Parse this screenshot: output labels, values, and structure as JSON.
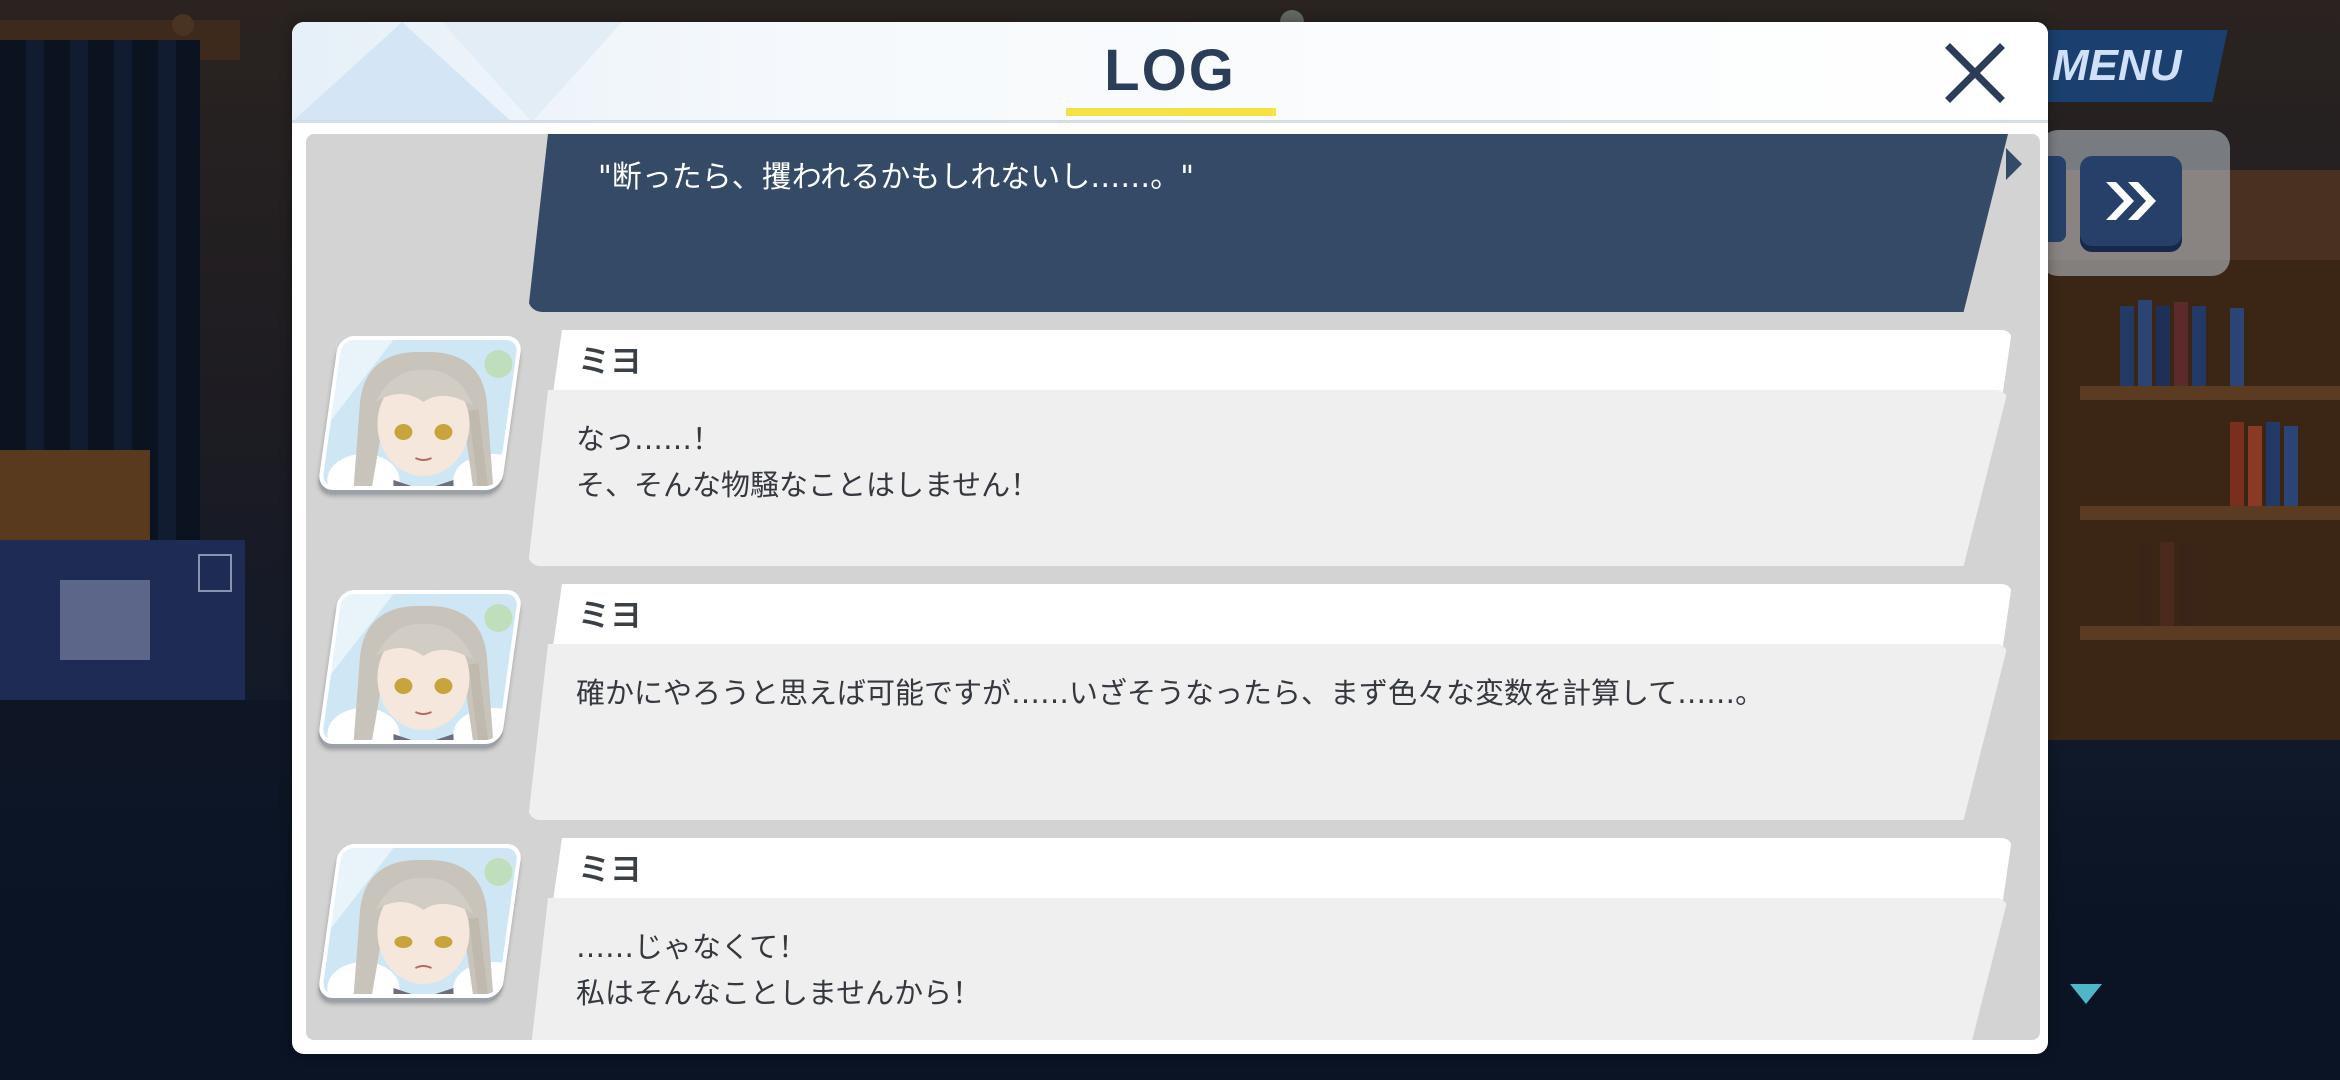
{
  "hud": {
    "menu_label": "MENU"
  },
  "log": {
    "title": "LOG",
    "narration": "\"断ったら、攫われるかもしれないし……。\"",
    "entries": [
      {
        "speaker": "ミヨ",
        "line1": "なっ……！",
        "line2": "そ、そんな物騒なことはしません！"
      },
      {
        "speaker": "ミヨ",
        "line1": "確かにやろうと思えば可能ですが……いざそうなったら、まず色々な変数を計算して……。",
        "line2": ""
      },
      {
        "speaker": "ミヨ",
        "line1": "……じゃなくて！",
        "line2": "私はそんなことしませんから！"
      }
    ]
  },
  "colors": {
    "title": "#2b3d58",
    "underline": "#f4e245",
    "narration_bg": "#344a66",
    "bubble_bg": "#efefef",
    "log_body_bg": "#d3d3d3",
    "menu_bg": "#1b3f6e"
  },
  "icons": {
    "close": "close-icon",
    "skip": "fast-forward-icon",
    "scroll": "triangle-down-icon"
  }
}
